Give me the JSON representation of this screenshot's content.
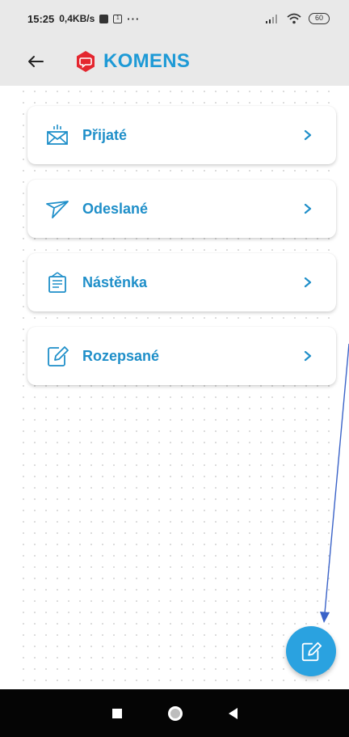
{
  "statusbar": {
    "time": "15:25",
    "network": "0,4KB/s",
    "more": "···",
    "battery": "60",
    "notif_icons": [
      "flipboard-icon",
      "calendar-icon"
    ]
  },
  "appbar": {
    "back_icon": "arrow-left-icon",
    "logo_icon": "komens-chat-icon",
    "title": "KOMENS"
  },
  "colors": {
    "accent": "#1e9ad6",
    "fab": "#2aa2e0",
    "logo_red": "#e4262f",
    "appbar_bg": "#e9e9e9",
    "annotation_arrow": "#3b63c8"
  },
  "menu": [
    {
      "label": "Přijaté",
      "icon": "inbox-envelope-icon"
    },
    {
      "label": "Odeslané",
      "icon": "paper-plane-icon"
    },
    {
      "label": "Nástěnka",
      "icon": "notice-board-icon"
    },
    {
      "label": "Rozepsané",
      "icon": "edit-draft-icon"
    }
  ],
  "fab": {
    "icon": "compose-icon"
  },
  "navbar": {
    "items": [
      "recents-square",
      "home-circle",
      "back-triangle"
    ]
  }
}
